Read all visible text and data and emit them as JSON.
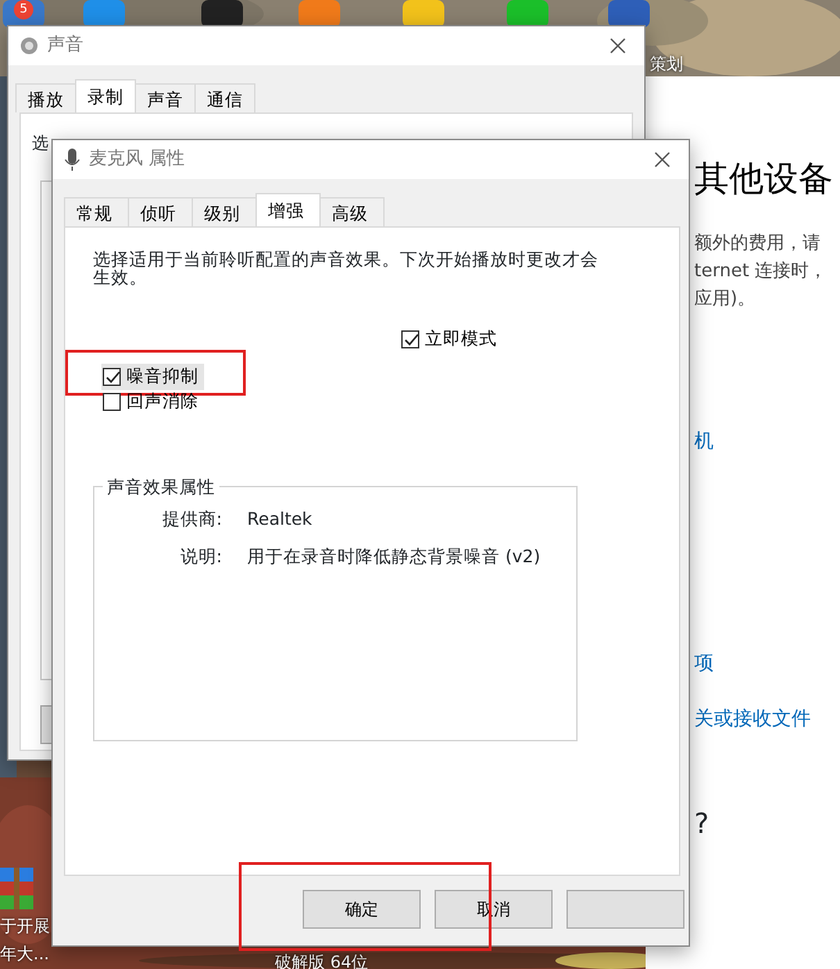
{
  "desktop": {
    "kind": "picture",
    "notification_badge": "5",
    "icon_labels": [
      {
        "text": "策划"
      },
      {
        "text": "于开展"
      },
      {
        "text": "年大..."
      },
      {
        "text": "破解版 64位"
      }
    ]
  },
  "sound_window": {
    "title": "声音",
    "tabs": [
      {
        "label": "播放",
        "selected": false
      },
      {
        "label": "录制",
        "selected": true
      },
      {
        "label": "声音",
        "selected": false
      },
      {
        "label": "通信",
        "selected": false
      }
    ],
    "content_text": "选"
  },
  "settings_panel": {
    "heading": "其他设备",
    "paragraph_lines": [
      "额外的费用，请",
      "ternet 连接时，",
      "应用)。"
    ],
    "links": [
      "机",
      "项",
      "关或接收文件"
    ],
    "question": "?"
  },
  "dialog": {
    "title": "麦克风 属性",
    "tabs": [
      {
        "label": "常规",
        "selected": false
      },
      {
        "label": "侦听",
        "selected": false
      },
      {
        "label": "级别",
        "selected": false
      },
      {
        "label": "增强",
        "selected": true
      },
      {
        "label": "高级",
        "selected": false
      }
    ],
    "description": "选择适用于当前聆听配置的声音效果。下次开始播放时更改才会生效。",
    "immediate_mode": {
      "label": "立即模式",
      "checked": true
    },
    "effects": [
      {
        "label": "噪音抑制",
        "checked": true,
        "highlighted": true,
        "annotated": true
      },
      {
        "label": "回声消除",
        "checked": false,
        "highlighted": false,
        "annotated": false
      }
    ],
    "properties_group": {
      "title": "声音效果属性",
      "rows": [
        {
          "label": "提供商:",
          "value": "Realtek"
        },
        {
          "label": "说明:",
          "value": "用于在录音时降低静态背景噪音 (v2)"
        }
      ]
    },
    "buttons": [
      {
        "kind": "labeled",
        "label": "确定",
        "annotated": true
      },
      {
        "kind": "labeled",
        "label": "取消",
        "annotated": true
      },
      {
        "kind": "blank"
      }
    ]
  }
}
